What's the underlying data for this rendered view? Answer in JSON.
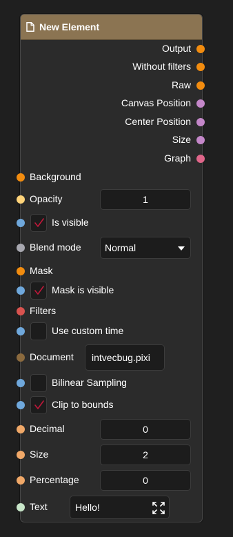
{
  "node": {
    "title": "New Element",
    "header_color": "#8b7452"
  },
  "outputs": [
    {
      "label": "Output",
      "color": "#f28c0f"
    },
    {
      "label": "Without filters",
      "color": "#f28c0f"
    },
    {
      "label": "Raw",
      "color": "#f28c0f"
    },
    {
      "label": "Canvas Position",
      "color": "#c487c9"
    },
    {
      "label": "Center Position",
      "color": "#c487c9"
    },
    {
      "label": "Size",
      "color": "#c487c9"
    },
    {
      "label": "Graph",
      "color": "#e0668a"
    }
  ],
  "inputs": {
    "background": {
      "label": "Background",
      "color": "#f28c0f"
    },
    "opacity": {
      "label": "Opacity",
      "value": "1",
      "color": "#ffd47a"
    },
    "is_visible": {
      "label": "Is visible",
      "checked": true,
      "color": "#6fa8dc"
    },
    "blend_mode": {
      "label": "Blend mode",
      "value": "Normal",
      "color": "#a8a8b0"
    },
    "mask": {
      "label": "Mask",
      "color": "#f28c0f"
    },
    "mask_is_visible": {
      "label": "Mask is visible",
      "checked": true,
      "color": "#6fa8dc"
    },
    "filters": {
      "label": "Filters",
      "color": "#d9534f"
    },
    "use_custom_time": {
      "label": "Use custom time",
      "checked": false,
      "color": "#6fa8dc"
    },
    "document": {
      "label": "Document",
      "value": "intvecbug.pixi",
      "color": "#8b6a3e"
    },
    "bilinear_sampling": {
      "label": "Bilinear Sampling",
      "checked": false,
      "color": "#6fa8dc"
    },
    "clip_to_bounds": {
      "label": "Clip to bounds",
      "checked": true,
      "color": "#6fa8dc"
    },
    "decimal": {
      "label": "Decimal",
      "value": "0",
      "color": "#f0a868"
    },
    "size": {
      "label": "Size",
      "value": "2",
      "color": "#f0a868"
    },
    "percentage": {
      "label": "Percentage",
      "value": "0",
      "color": "#f0a868"
    },
    "text": {
      "label": "Text",
      "value": "Hello!",
      "color": "#c8e6c9"
    }
  },
  "icons": {
    "header": "document-icon",
    "check": "checkmark-icon",
    "dropdown": "caret-down-icon",
    "text_expand": "expand-icon"
  },
  "colors": {
    "check_mark": "#c0183a",
    "node_bg": "#2b2b2b",
    "field_bg": "#1c1c1c"
  }
}
